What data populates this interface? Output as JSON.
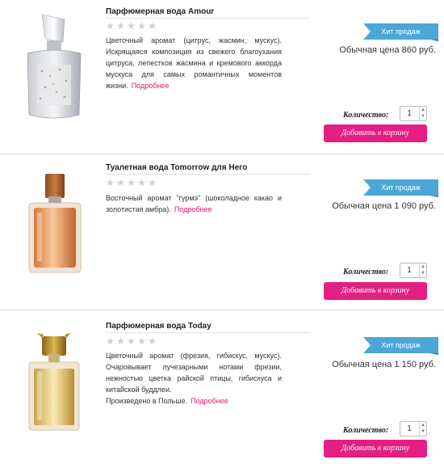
{
  "products": [
    {
      "title": "Парфюмерная вода Amour",
      "description": "Цветочный аромат (цитрус, жасмин, мускус). Искрящаяся композиция из свежего благоухания цитруса, лепестков жасмина и кремового аккорда мускуса для самых романтичных моментов жизни.",
      "more_label": "Подробнее",
      "badge": "Хит продаж",
      "price": "Обычная цена 860 руб.",
      "quantity_label": "Количество:",
      "quantity": "1",
      "cart_label": "Добавить в корзину",
      "rating": 0
    },
    {
      "title": "Туалетная вода Tomorrow для Него",
      "description": "Восточный аромат \"гурмэ\" (шоколадное какао и золотистая амбра).",
      "more_label": "Подробнее",
      "badge": "Хит продаж",
      "price": "Обычная цена 1 090 руб.",
      "quantity_label": "Количество:",
      "quantity": "1",
      "cart_label": "Добавить в корзину",
      "rating": 0
    },
    {
      "title": "Парфюмерная вода Today",
      "description": "Цветочный аромат (фрезия, гибискус, мускус). Очаровывает лучезарными нотами фрезии, нежностью цветка райской птицы, гибискуса и китайской буддлеи.",
      "description_extra": "Произведено в Польше.",
      "more_label": "Подробнее",
      "badge": "Хит продаж",
      "price": "Обычная цена 1 150 руб.",
      "quantity_label": "Количество:",
      "quantity": "1",
      "cart_label": "Добавить в корзину",
      "rating": 0
    }
  ],
  "colors": {
    "accent": "#e51e82",
    "badge": "#4aa7d8",
    "link": "#e0156b",
    "star_empty": "#cfcfcf"
  }
}
